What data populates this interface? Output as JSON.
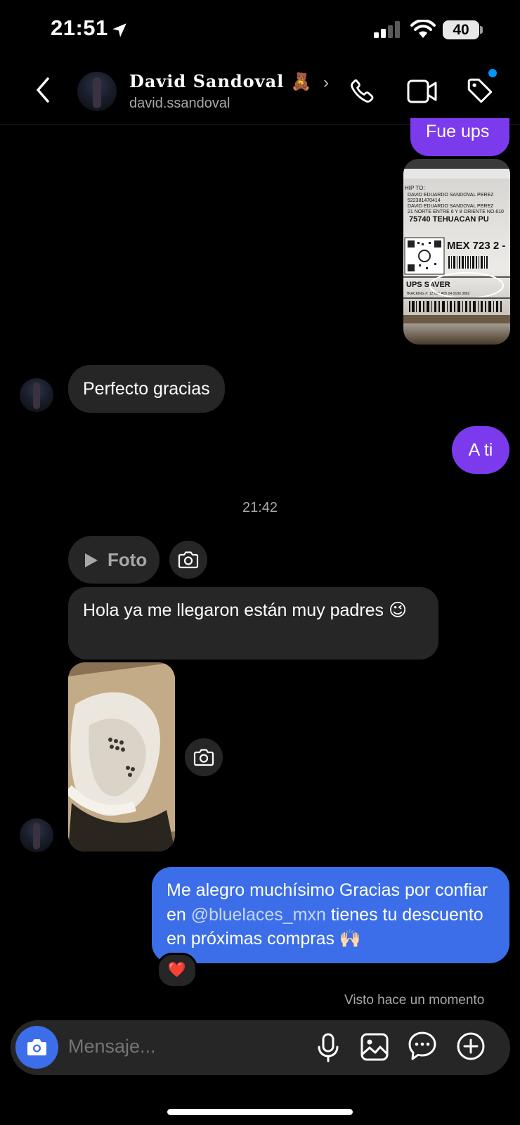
{
  "status_bar": {
    "time": "21:51",
    "battery": "40"
  },
  "header": {
    "name": "David Sandoval 🧸",
    "chevron": "›",
    "username": "david.ssandoval"
  },
  "messages": {
    "fue_ups": "Fue ups",
    "perfecto": "Perfecto gracias",
    "a_ti": "A ti",
    "timestamp": "21:42",
    "foto_label": "Foto",
    "hola": "Hola ya me llegaron están muy padres 😉",
    "reply_part1": "Me alegro muchísimo Gracias por confiar en ",
    "reply_mention": "@bluelaces_mxn",
    "reply_part2": " tienes tu descuento en próximas compras 🙌🏻",
    "reaction": "❤️",
    "seen": "Visto hace un momento"
  },
  "label_image": {
    "line1": "HIP TO:",
    "line2": "DAVID EDUARDO   SANDOVAL PEREZ",
    "line3": "522381470414",
    "line4": "DAVID EDUARDO   SANDOVAL PEREZ",
    "line5": "21 NORTE ENTRE 6 Y 8 ORIENTE NO.610",
    "line6": "75740  TEHUACAN  PU",
    "big": "MEX 723 2 -",
    "service": "UPS SAVER",
    "tracking": "TRACKING #: 1Z 656 A05 04 9180 3862"
  },
  "composer": {
    "placeholder": "Mensaje..."
  },
  "colors": {
    "purple": "#7c3aed",
    "blue": "#3b6ee8",
    "bubble_in": "#262626",
    "notif": "#0095f6"
  },
  "icons": [
    "location-arrow-icon",
    "signal-icon",
    "wifi-icon",
    "back-icon",
    "phone-icon",
    "video-icon",
    "tag-icon",
    "play-icon",
    "camera-icon",
    "mic-icon",
    "gallery-icon",
    "sticker-icon",
    "plus-icon"
  ]
}
